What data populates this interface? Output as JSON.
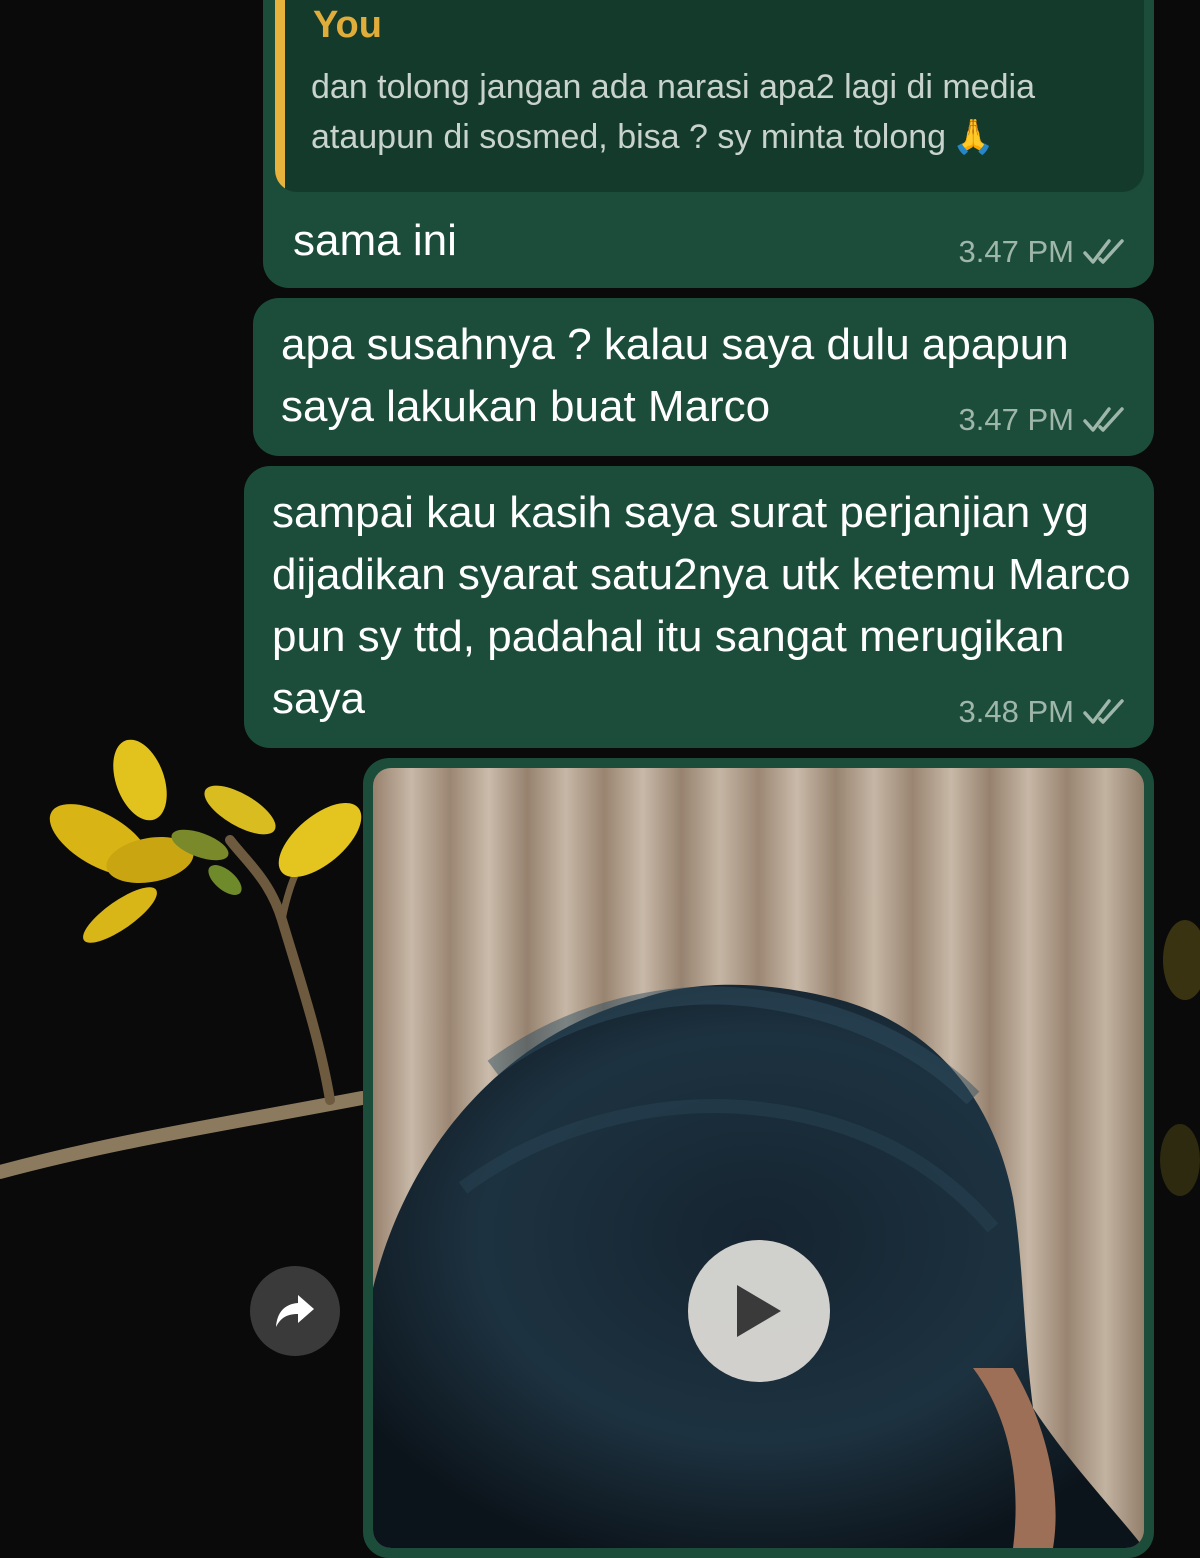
{
  "chat": {
    "messages": [
      {
        "reply_to": {
          "author": "You",
          "text": "dan tolong jangan ada narasi apa2 lagi di media ataupun di sosmed, bisa ? sy minta tolong",
          "emoji": "🙏"
        },
        "text": "sama ini",
        "time": "3.47 PM",
        "status": "read"
      },
      {
        "text": "apa susahnya ? kalau saya dulu apapun saya lakukan buat Marco",
        "time": "3.47 PM",
        "status": "read"
      },
      {
        "text": "sampai kau kasih saya surat perjanjian yg dijadikan syarat satu2nya utk ketemu Marco pun sy ttd, padahal itu sangat merugikan saya",
        "time": "3.48 PM",
        "status": "read"
      },
      {
        "type": "video",
        "play_icon": "play-icon"
      }
    ],
    "forward_icon": "forward-arrow-icon"
  },
  "colors": {
    "background": "#0a0a0a",
    "bubble": "#1b4d3a",
    "quote_bg": "#143a2b",
    "quote_accent": "#e8b33c",
    "meta_text": "#9fb6aa"
  }
}
